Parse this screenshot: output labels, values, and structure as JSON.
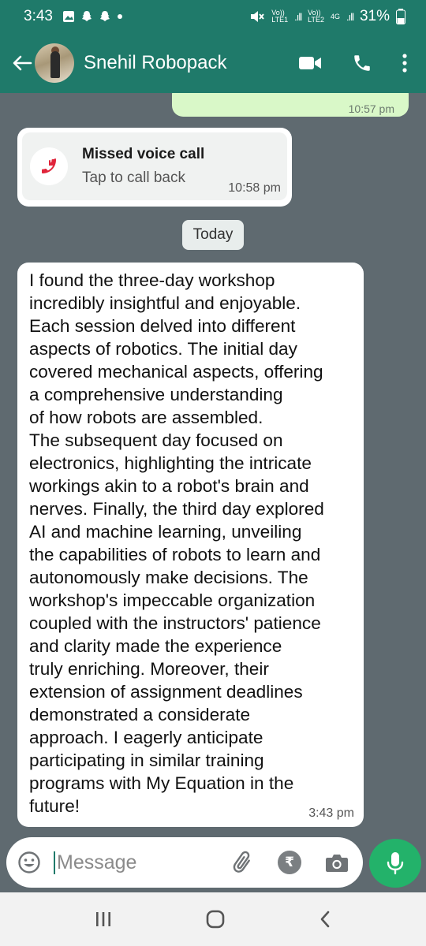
{
  "status_bar": {
    "time": "3:43",
    "battery": "31%",
    "sim1_label": "Vo))\nLTE1",
    "sim2_label": "Vo))\nLTE2",
    "net_label": "4G"
  },
  "header": {
    "contact_name": "Snehil Robopack"
  },
  "chat": {
    "previous_out_time": "10:57 pm",
    "missed_call": {
      "title": "Missed voice call",
      "subtitle": "Tap to call back",
      "time": "10:58 pm"
    },
    "day_divider": "Today",
    "message": {
      "text": "I found the three-day workshop\nincredibly insightful and enjoyable.\nEach session delved into different\naspects of robotics. The initial day\ncovered mechanical aspects, offering\na comprehensive understanding\nof how robots are assembled.\nThe subsequent day focused on\nelectronics, highlighting the intricate\nworkings akin to a robot's brain and\nnerves. Finally, the third day explored\nAI and machine learning, unveiling\nthe capabilities of robots to learn and\nautonomously make decisions. The\nworkshop's impeccable organization\ncoupled with the instructors' patience\nand clarity made the experience\ntruly enriching. Moreover, their\nextension of assignment deadlines\ndemonstrated a considerate\napproach. I eagerly anticipate\nparticipating in similar training\nprograms with My Equation in the\nfuture!",
      "time": "3:43 pm"
    }
  },
  "composer": {
    "placeholder": "Message",
    "rupee_symbol": "₹"
  },
  "colors": {
    "header_teal": "#1f7a6a",
    "mic_green": "#23b26a",
    "missed_red": "#e0243a",
    "chat_bg": "#5f6a70"
  }
}
